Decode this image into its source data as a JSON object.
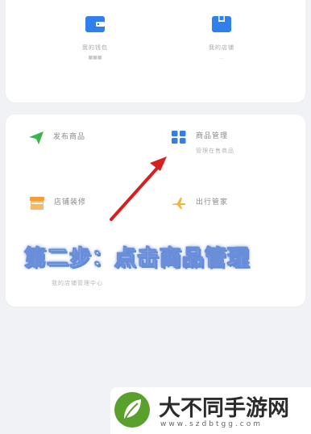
{
  "top_card": {
    "tiles": [
      {
        "icon": "wallet-icon",
        "label": "我的钱包",
        "sub": "■■■"
      },
      {
        "icon": "store-box-icon",
        "label": "我的店铺",
        "sub": "…"
      }
    ]
  },
  "menu": {
    "items": [
      {
        "icon": "paper-plane-icon",
        "label": "发布商品",
        "sub": ""
      },
      {
        "icon": "grid-apps-icon",
        "label": "商品管理",
        "sub": "管理在售商品"
      },
      {
        "icon": "storefront-icon",
        "label": "店铺装修",
        "sub": ""
      },
      {
        "icon": "airplane-icon",
        "label": "出行管家",
        "sub": ""
      }
    ],
    "extra_sub": "我的店铺管理中心"
  },
  "annotation": {
    "caption": "第二步：点击商品管理"
  },
  "watermark": {
    "title": "大不同手游网",
    "url": "www.szdbtgg.com"
  },
  "colors": {
    "accent_blue": "#2f80ed",
    "green": "#39b54a",
    "orange": "#f29d38",
    "red_arrow": "#d62020",
    "caption_glow": "#5b85d9",
    "watermark_green": "#5aa02c"
  }
}
